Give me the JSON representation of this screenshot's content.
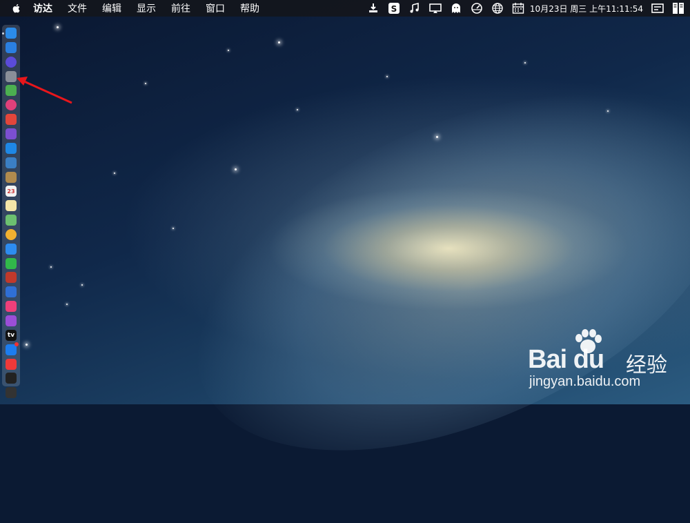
{
  "menubar": {
    "menus": [
      "访达",
      "文件",
      "编辑",
      "显示",
      "前往",
      "窗口",
      "帮助"
    ],
    "status_icons": [
      "download-icon",
      "sogou-input-icon",
      "music-note-icon",
      "display-mirror-icon",
      "ghost-icon",
      "gauge-icon",
      "globe-icon",
      "calendar-icon"
    ],
    "clock": "10月23日 周三 上午11:11:54"
  },
  "dock": {
    "items": [
      {
        "name": "finder",
        "color": "#2b8be8"
      },
      {
        "name": "app-store-a",
        "color": "#2a7fe0"
      },
      {
        "name": "siri",
        "color": "#5b4bd9"
      },
      {
        "name": "launchpad",
        "color": "#8a8f99"
      },
      {
        "name": "android-studio",
        "color": "#4caf50"
      },
      {
        "name": "color-wheel",
        "color": "#e0407a"
      },
      {
        "name": "red-app",
        "color": "#e2463b"
      },
      {
        "name": "purple-app",
        "color": "#7b4fd1"
      },
      {
        "name": "safari",
        "color": "#1e88e5"
      },
      {
        "name": "preview",
        "color": "#3b7fc4"
      },
      {
        "name": "notes-book",
        "color": "#b08a4e"
      },
      {
        "name": "calendar",
        "color": "#f2f2f2",
        "label": "23"
      },
      {
        "name": "notes",
        "color": "#f5e6a8"
      },
      {
        "name": "maps",
        "color": "#6cc070"
      },
      {
        "name": "photos",
        "color": "#f0b030"
      },
      {
        "name": "messages",
        "color": "#2d8cf0"
      },
      {
        "name": "facetime",
        "color": "#31b84a"
      },
      {
        "name": "photo-booth",
        "color": "#c0392b"
      },
      {
        "name": "keynote",
        "color": "#2f6fd6"
      },
      {
        "name": "itunes",
        "color": "#ee3f7a"
      },
      {
        "name": "podcasts",
        "color": "#9b4ed8"
      },
      {
        "name": "apple-tv",
        "color": "#111111",
        "label": "tv"
      },
      {
        "name": "app-store",
        "color": "#1c7df0"
      },
      {
        "name": "vivaldi",
        "color": "#ef3939"
      },
      {
        "name": "terminal",
        "color": "#222222"
      },
      {
        "name": "activity-monitor",
        "color": "#333333"
      }
    ]
  },
  "annotation": {
    "arrow_color": "#e8161b"
  },
  "watermark": {
    "brand": "Bai du",
    "product": "经验",
    "url": "jingyan.baidu.com"
  }
}
